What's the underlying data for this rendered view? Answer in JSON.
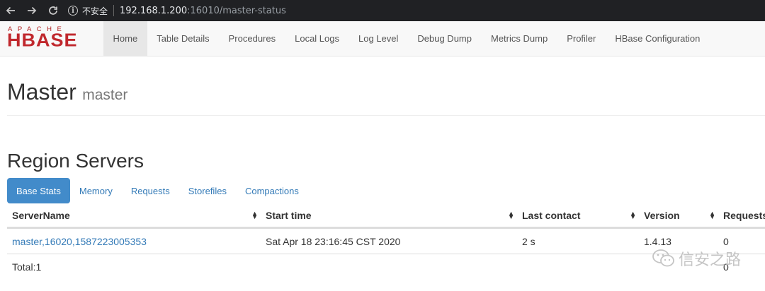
{
  "browser": {
    "insecure_label": "不安全",
    "url_host": "192.168.1.200",
    "url_rest": ":16010/master-status"
  },
  "logo": {
    "top": "APACHE",
    "main": "HBASE"
  },
  "nav": {
    "items": [
      {
        "label": "Home"
      },
      {
        "label": "Table Details"
      },
      {
        "label": "Procedures"
      },
      {
        "label": "Local Logs"
      },
      {
        "label": "Log Level"
      },
      {
        "label": "Debug Dump"
      },
      {
        "label": "Metrics Dump"
      },
      {
        "label": "Profiler"
      },
      {
        "label": "HBase Configuration"
      }
    ]
  },
  "header": {
    "title": "Master",
    "subtitle": "master"
  },
  "region_servers": {
    "title": "Region Servers",
    "tabs": [
      {
        "label": "Base Stats"
      },
      {
        "label": "Memory"
      },
      {
        "label": "Requests"
      },
      {
        "label": "Storefiles"
      },
      {
        "label": "Compactions"
      }
    ],
    "columns": [
      "ServerName",
      "Start time",
      "Last contact",
      "Version",
      "Requests"
    ],
    "rows": [
      {
        "server": "master,16020,1587223005353",
        "start": "Sat Apr 18 23:16:45 CST 2020",
        "last_contact": "2 s",
        "version": "1.4.13",
        "requests": "0"
      }
    ],
    "total": {
      "label": "Total:1",
      "requests": "0"
    }
  },
  "watermark": {
    "text": "信安之路"
  },
  "colors": {
    "accent": "#428bca",
    "link": "#337ab7",
    "brand": "#c0282d"
  }
}
